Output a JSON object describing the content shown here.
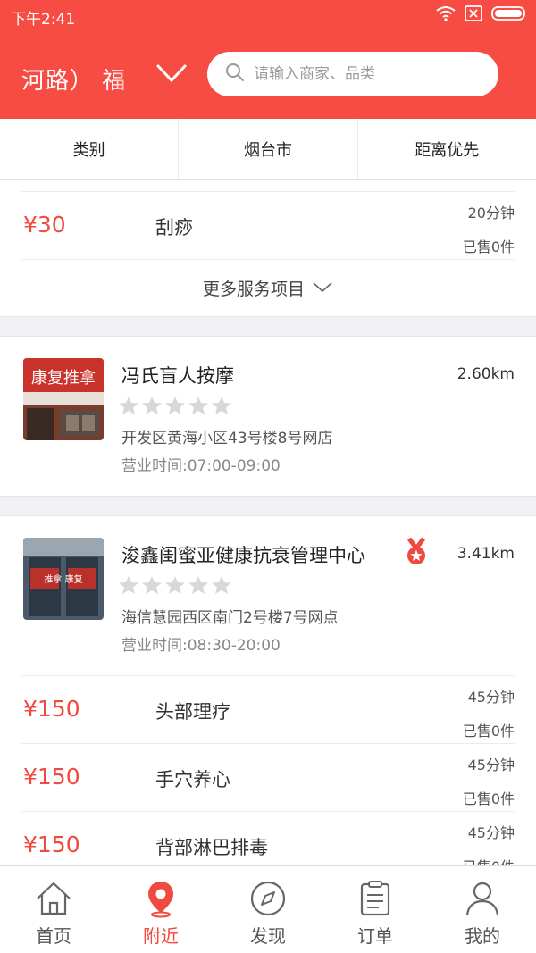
{
  "status_bar": {
    "time": "下午2:41"
  },
  "header": {
    "location": "河路） 福",
    "search": {
      "placeholder": "请输入商家、品类",
      "value": ""
    }
  },
  "filters": [
    "类别",
    "烟台市",
    "距离优先"
  ],
  "top_card": {
    "services": [
      {
        "price": "¥30",
        "name": "刮痧",
        "duration": "20分钟",
        "sold": "已售0件"
      }
    ],
    "more_label": "更多服务项目"
  },
  "shops": [
    {
      "thumb_text": "康复推拿",
      "name": "冯氏盲人按摩",
      "distance": "2.60km",
      "rating": 0,
      "address": "开发区黄海小区43号楼8号网店",
      "hours": "营业时间:07:00-09:00",
      "badge": false,
      "services": []
    },
    {
      "thumb_text": "推拿 康复",
      "name": "浚鑫闺蜜亚健康抗衰管理中心",
      "distance": "3.41km",
      "rating": 0,
      "address": "海信慧园西区南门2号楼7号网点",
      "hours": "营业时间:08:30-20:00",
      "badge": true,
      "services": [
        {
          "price": "¥150",
          "name": "头部理疗",
          "duration": "45分钟",
          "sold": "已售0件"
        },
        {
          "price": "¥150",
          "name": "手穴养心",
          "duration": "45分钟",
          "sold": "已售0件"
        },
        {
          "price": "¥150",
          "name": "背部淋巴排毒",
          "duration": "45分钟",
          "sold": "已售0件"
        }
      ]
    }
  ],
  "tabbar": {
    "home": "首页",
    "nearby": "附近",
    "discover": "发现",
    "orders": "订单",
    "mine": "我的",
    "active": "nearby"
  },
  "colors": {
    "brand": "#f64c43",
    "price": "#f0493f",
    "star": "#d8d8d8"
  }
}
